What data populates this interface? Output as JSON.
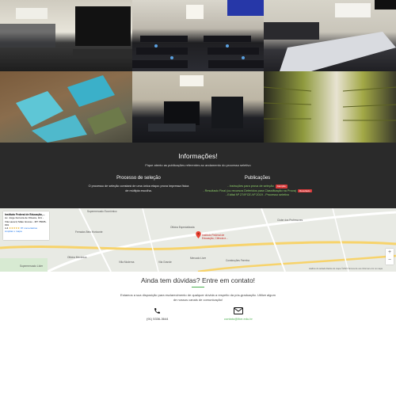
{
  "info": {
    "title": "Informações!",
    "subtitle": "Fique atento as publicações referentes ao andamento do processo seletivo",
    "left": {
      "title": "Processo de seleção",
      "text": "O processo de seleção constará de uma única etapa: prova impressa física de múltipla escolha."
    },
    "right": {
      "title": "Publicações",
      "items": [
        {
          "label": "- Instruções para prova de seleção",
          "badge": "Atenção"
        },
        {
          "label": "- Resultado Final (ou recursos Deferidos para Classificação na Prova)",
          "badge": "Resultado"
        },
        {
          "label": "- Edital Nº 27/IFCE-Nº 2019 - Processo seletivo",
          "badge": ""
        }
      ]
    }
  },
  "map": {
    "place_title": "Instituto Federal de Educação,...",
    "place_address": "Av. Jorge Ferreira de Oliveira, 101 - Vila Lacerd, Mato Grosso - MT 78005-001",
    "rating_value": "4.4",
    "rating_stars": "★★★★★",
    "reviews": "87 comentários",
    "larger_map": "Ampliar o mapa",
    "labels": {
      "pin": "Instituto Federal de Educação, Ciência e...",
      "a": "Supermercado Econômico",
      "b": "Oficina Especializada",
      "c": "Clube dos Professores",
      "d": "Vila Grande",
      "e": "Mercado Livre",
      "f": "Supermercado Líder",
      "g": "Oficina Mecânica",
      "h": "Ferrados Belo Horizonte",
      "i": "Villa Moderna",
      "j": "Construções Ferreira"
    },
    "footer": "Atalhos do teclado   Dados do mapa ©2023   Termos de uso   Informar erro no mapa"
  },
  "contact": {
    "title": "Ainda tem dúvidas? Entre em contato!",
    "text": "Estamos a sua disposição para esclarecimento de qualquer dúvida a respeito da pós-graduação. Utilize algum de nossos canais de comunicação!",
    "phone": "(91) 5336-3644",
    "email": "contato@ifce.edu.br"
  },
  "icons": {
    "phone": "phone-icon",
    "email": "envelope-icon",
    "pin": "map-pin-icon"
  },
  "colors": {
    "accent": "#4caf50",
    "badge": "#d93b3b",
    "pin": "#ea4335",
    "dark_section": "#2a2a2a"
  }
}
